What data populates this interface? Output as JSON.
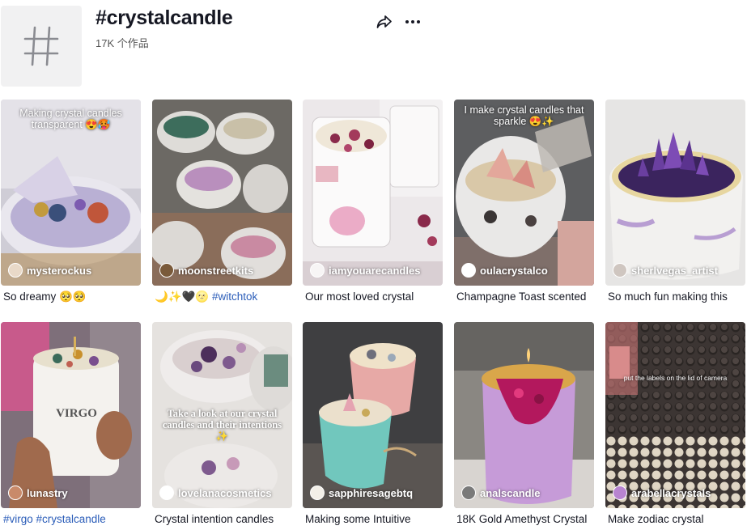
{
  "header": {
    "title": "#crystalcandle",
    "subtitle": "17K 个作品",
    "hash_icon": "hash-icon",
    "share_icon": "share-icon",
    "more_icon": "more-icon"
  },
  "videos": [
    {
      "creator": "mysterockus",
      "overlay": "Making crystal candles transparent 😍🥵",
      "caption": "So dreamy 🥺🥺",
      "caption_tag": "",
      "colors": [
        "#d9d6df",
        "#9a8fb6"
      ]
    },
    {
      "creator": "moonstreetkits",
      "overlay": "",
      "caption": "🌙✨🖤🌝",
      "caption_tag": " #witchtok",
      "colors": [
        "#6b6a66",
        "#b7a59f"
      ]
    },
    {
      "creator": "iamyouarecandles",
      "overlay": "",
      "caption": "Our most loved crystal",
      "caption_tag": "",
      "colors": [
        "#f0ecef",
        "#c9c2c6"
      ]
    },
    {
      "creator": "oulacrystalco",
      "overlay": "I make crystal candles that sparkle 😍✨",
      "caption": "Champagne Toast scented",
      "caption_tag": "",
      "colors": [
        "#5c5d5e",
        "#9c8c88"
      ]
    },
    {
      "creator": "sherlvegas_artist",
      "overlay": "",
      "caption": "So much fun making this",
      "caption_tag": "",
      "colors": [
        "#e8e7e6",
        "#d7d5d3"
      ]
    },
    {
      "creator": "lunastry",
      "overlay": "",
      "caption": "",
      "caption_tag": "#virgo #crystalcandle",
      "colors": [
        "#d96f8e",
        "#7f6a78"
      ]
    },
    {
      "creator": "lovelanacosmetics",
      "overlay": "Take a look at our crystal candles and their intentions ✨",
      "caption": "Crystal intention candles",
      "caption_tag": "",
      "colors": [
        "#e8e5e3",
        "#cfcac8"
      ]
    },
    {
      "creator": "sapphiresagebtq",
      "overlay": "",
      "caption": "Making some Intuitive",
      "caption_tag": "",
      "colors": [
        "#3f3f41",
        "#6c6665"
      ]
    },
    {
      "creator": "analscandle",
      "overlay": "",
      "caption": "18K Gold Amethyst Crystal",
      "caption_tag": "",
      "colors": [
        "#8c8883",
        "#d8d3cf"
      ]
    },
    {
      "creator": "arabellacrystals",
      "overlay": "put the labels on the lid of camera",
      "caption": "Make zodiac crystal",
      "caption_tag": "",
      "colors": [
        "#3a3432",
        "#5b4e48"
      ]
    }
  ]
}
